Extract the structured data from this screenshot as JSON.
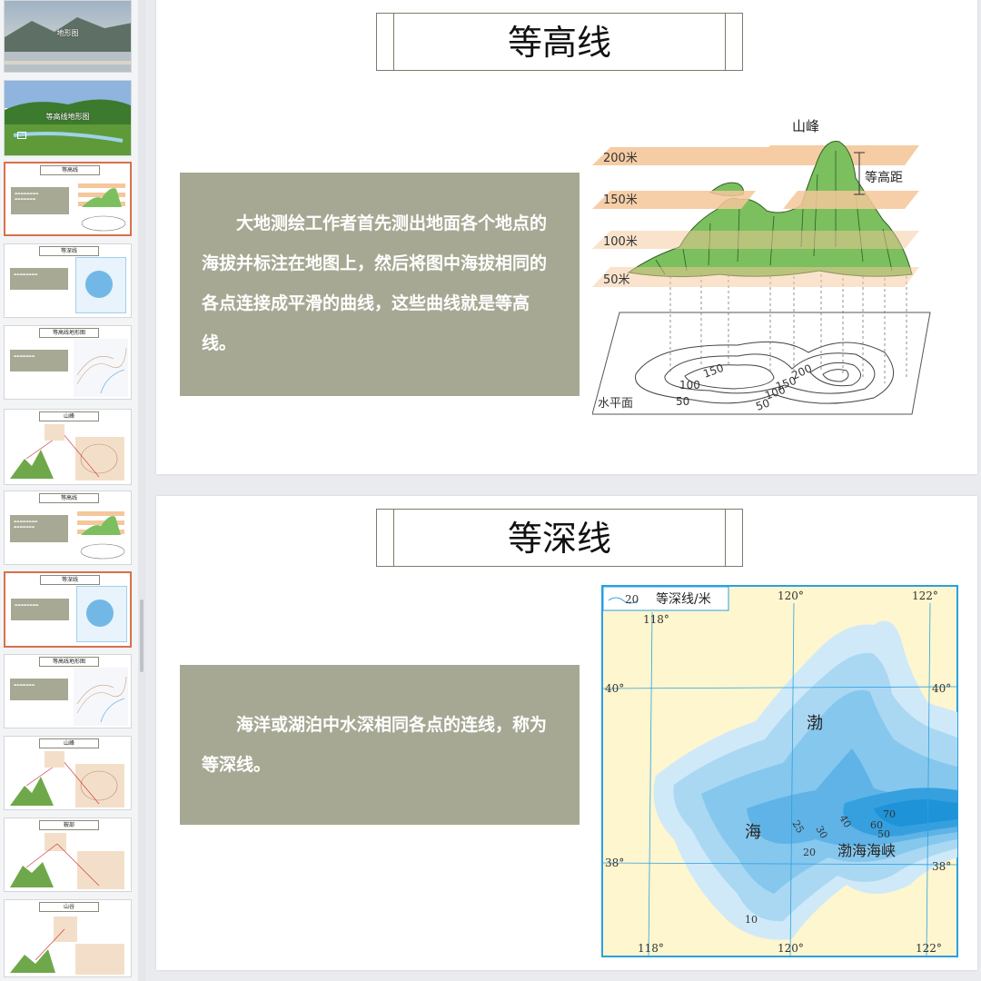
{
  "thumbnails": [
    {
      "type": "photo",
      "label": "地形图",
      "scene": "lake"
    },
    {
      "type": "photo",
      "label": "等高线地形图",
      "scene": "grassland"
    },
    {
      "type": "slide",
      "title": "等高线",
      "kind": "contour",
      "selected": true
    },
    {
      "type": "slide",
      "title": "等深线",
      "kind": "depth",
      "selected": false
    },
    {
      "type": "slide",
      "title": "等高线地形图",
      "kind": "map",
      "selected": false
    },
    {
      "type": "slide",
      "title": "山峰",
      "kind": "peak",
      "selected": false
    },
    {
      "type": "slide",
      "title": "等高线",
      "kind": "contour",
      "selected": false
    },
    {
      "type": "slide",
      "title": "等深线",
      "kind": "depth",
      "selected": true
    },
    {
      "type": "slide",
      "title": "等高线地形图",
      "kind": "map",
      "selected": false
    },
    {
      "type": "slide",
      "title": "山峰",
      "kind": "peak",
      "selected": false
    },
    {
      "type": "slide",
      "title": "鞍部",
      "kind": "peak",
      "selected": false
    },
    {
      "type": "slide",
      "title": "山谷",
      "kind": "valley",
      "selected": false
    }
  ],
  "slide1": {
    "title": "等高线",
    "body": "大地测绘工作者首先测出地面各个地点的海拔并标注在地图上，然后将图中海拔相同的各点连接成平滑的曲线，这些曲线就是等高线。",
    "figure": {
      "peak_label": "山峰",
      "interval_label": "等高距",
      "levels": [
        "200米",
        "150米",
        "100米",
        "50米"
      ],
      "contour_values": [
        "150",
        "100",
        "50",
        "200",
        "150",
        "100",
        "50"
      ],
      "plane_label": "水平面"
    }
  },
  "slide2": {
    "title": "等深线",
    "body": "海洋或湖泊中水深相同各点的连线，称为等深线。",
    "map": {
      "legend_value": "20",
      "legend_label": "等深线/米",
      "lon_top": [
        "120°",
        "122°"
      ],
      "lon_inner": "118°",
      "lon_bottom": [
        "118°",
        "120°",
        "122°"
      ],
      "lat": [
        "40°",
        "40°",
        "38°",
        "38°"
      ],
      "labels": {
        "bo": "渤",
        "hai": "海",
        "strait": "渤海海峡"
      },
      "depths": [
        "25",
        "30",
        "40",
        "70",
        "60",
        "50",
        "20",
        "10"
      ]
    }
  },
  "colors": {
    "accent_box": "#a6a893",
    "selected_border": "#d9704a",
    "water_deep": "#1f93d8",
    "land": "#fdf6cf",
    "map_frame": "#2aa0e0"
  }
}
